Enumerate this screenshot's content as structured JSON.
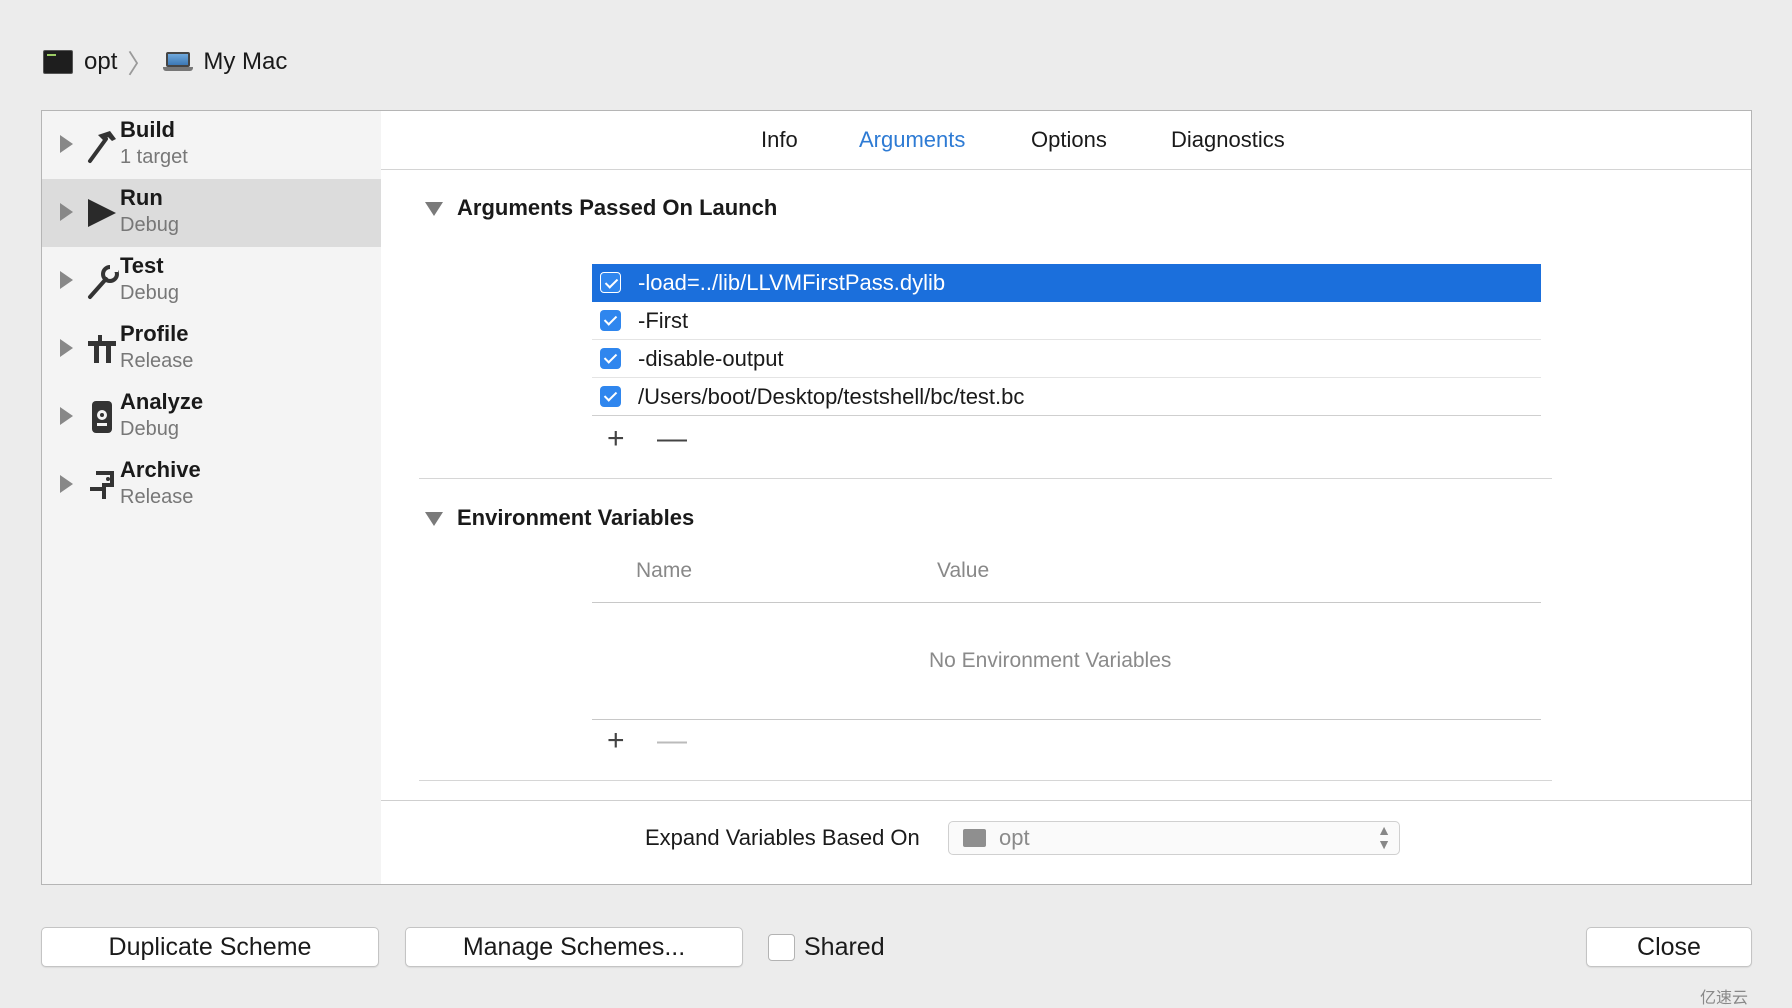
{
  "breadcrumb": {
    "scheme": "opt",
    "destination": "My Mac"
  },
  "sidebar": {
    "items": [
      {
        "title": "Build",
        "subtitle": "1 target",
        "icon": "hammer-icon"
      },
      {
        "title": "Run",
        "subtitle": "Debug",
        "icon": "play-icon"
      },
      {
        "title": "Test",
        "subtitle": "Debug",
        "icon": "wrench-icon"
      },
      {
        "title": "Profile",
        "subtitle": "Release",
        "icon": "tool-icon"
      },
      {
        "title": "Analyze",
        "subtitle": "Debug",
        "icon": "analyze-icon"
      },
      {
        "title": "Archive",
        "subtitle": "Release",
        "icon": "archive-icon"
      }
    ],
    "selected": "Run"
  },
  "tabs": [
    {
      "label": "Info"
    },
    {
      "label": "Arguments",
      "active": true
    },
    {
      "label": "Options"
    },
    {
      "label": "Diagnostics"
    }
  ],
  "arguments": {
    "title": "Arguments Passed On Launch",
    "items": [
      {
        "text": "-load=../lib/LLVMFirstPass.dylib",
        "checked": true,
        "selected": true
      },
      {
        "text": "-First",
        "checked": true
      },
      {
        "text": "-disable-output",
        "checked": true
      },
      {
        "text": "/Users/boot/Desktop/testshell/bc/test.bc",
        "checked": true
      }
    ],
    "add_label": "+",
    "remove_label": "—"
  },
  "environment": {
    "title": "Environment Variables",
    "columns": [
      "Name",
      "Value"
    ],
    "empty_message": "No Environment Variables",
    "add_label": "+",
    "remove_label": "—"
  },
  "expand": {
    "label": "Expand Variables Based On",
    "value": "opt"
  },
  "footer": {
    "duplicate": "Duplicate Scheme",
    "manage": "Manage Schemes...",
    "shared": "Shared",
    "close": "Close"
  },
  "watermark": "亿速云",
  "colors": {
    "accent": "#2e7bd4",
    "selection": "#1b6fdc",
    "checkbox": "#2f86ee"
  }
}
